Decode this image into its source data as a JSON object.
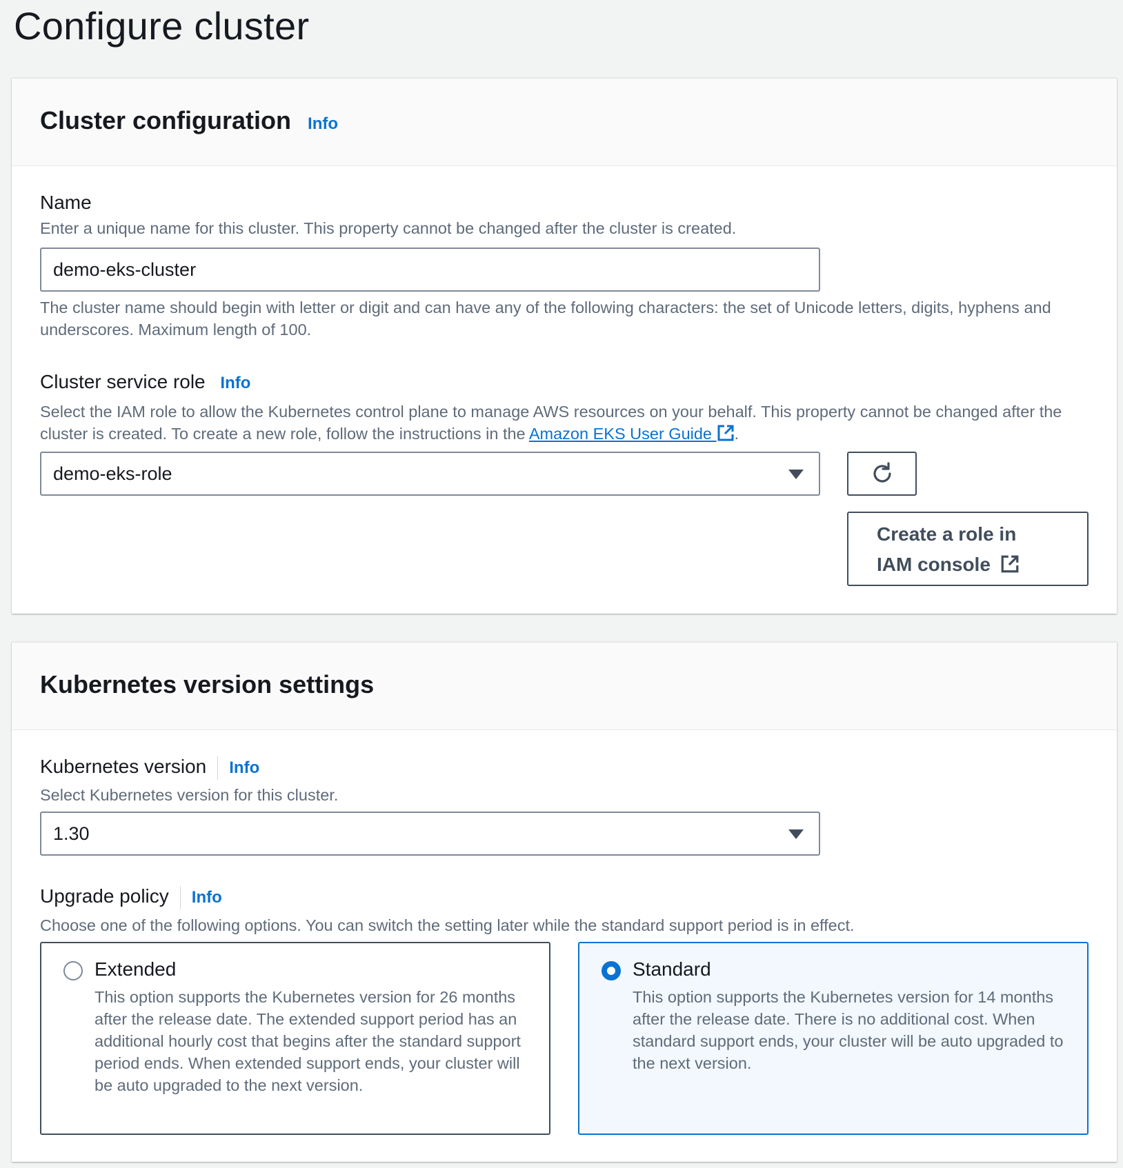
{
  "page": {
    "title": "Configure cluster"
  },
  "cluster_configuration": {
    "title": "Cluster configuration",
    "info_label": "Info",
    "name": {
      "label": "Name",
      "description": "Enter a unique name for this cluster. This property cannot be changed after the cluster is created.",
      "value": "demo-eks-cluster",
      "constraint": "The cluster name should begin with letter or digit and can have any of the following characters: the set of Unicode letters, digits, hyphens and underscores. Maximum length of 100."
    },
    "service_role": {
      "label": "Cluster service role",
      "info_label": "Info",
      "description_prefix": "Select the IAM role to allow the Kubernetes control plane to manage AWS resources on your behalf. This property cannot be changed after the cluster is created. To create a new role, follow the instructions in the",
      "guide_link": "Amazon EKS User Guide",
      "description_suffix": ".",
      "selected_value": "demo-eks-role",
      "create_role_button": "Create a role in IAM console",
      "refresh_icon": "refresh-icon"
    }
  },
  "kubernetes_version_settings": {
    "title": "Kubernetes version settings",
    "version": {
      "label": "Kubernetes version",
      "info_label": "Info",
      "description": "Select Kubernetes version for this cluster.",
      "selected_value": "1.30"
    },
    "upgrade_policy": {
      "label": "Upgrade policy",
      "info_label": "Info",
      "description": "Choose one of the following options. You can switch the setting later while the standard support period is in effect.",
      "options": [
        {
          "title": "Extended",
          "description": "This option supports the Kubernetes version for 26 months after the release date. The extended support period has an additional hourly cost that begins after the standard support period ends. When extended support ends, your cluster will be auto upgraded to the next version.",
          "selected": false
        },
        {
          "title": "Standard",
          "description": "This option supports the Kubernetes version for 14 months after the release date. There is no additional cost. When standard support ends, your cluster will be auto upgraded to the next version.",
          "selected": true
        }
      ]
    }
  },
  "colors": {
    "accent": "#0972d3",
    "page_bg": "#f2f3f3",
    "text": "#16191f",
    "muted": "#5f6b7a"
  }
}
